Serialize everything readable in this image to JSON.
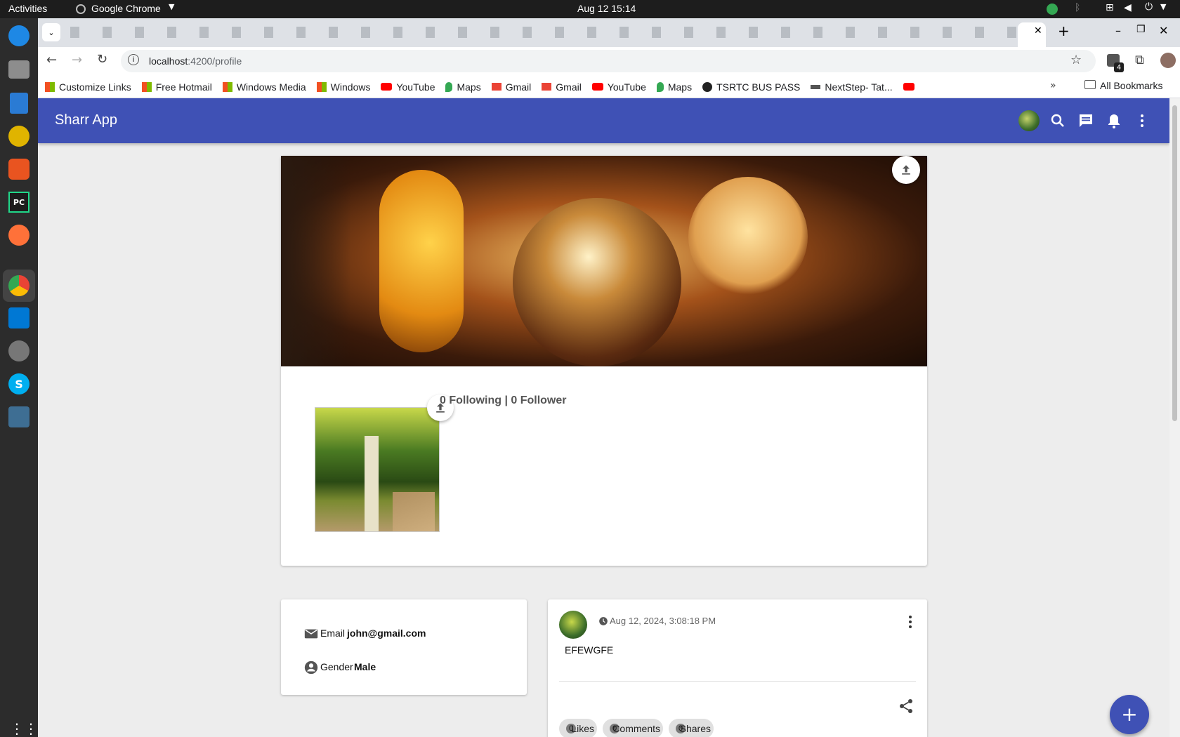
{
  "os": {
    "activities": "Activities",
    "app_name": "Google Chrome",
    "clock": "Aug 12  15:14"
  },
  "browser": {
    "url_host": "localhost",
    "url_path": ":4200/profile",
    "extensions_badge": "4",
    "bookmarks": [
      {
        "label": "Customize Links",
        "icon": "windows"
      },
      {
        "label": "Free Hotmail",
        "icon": "windows"
      },
      {
        "label": "Windows Media",
        "icon": "windows"
      },
      {
        "label": "Windows",
        "icon": "windows"
      },
      {
        "label": "YouTube",
        "icon": "youtube"
      },
      {
        "label": "Maps",
        "icon": "maps"
      },
      {
        "label": "Gmail",
        "icon": "gmail"
      },
      {
        "label": "Gmail",
        "icon": "gmail"
      },
      {
        "label": "YouTube",
        "icon": "youtube"
      },
      {
        "label": "Maps",
        "icon": "maps"
      },
      {
        "label": "TSRTC BUS PASS",
        "icon": "globe"
      },
      {
        "label": "NextStep- Tat...",
        "icon": "tcs"
      }
    ],
    "all_bookmarks": "All Bookmarks"
  },
  "app": {
    "title": "Sharr App",
    "brand_color": "#3f51b5"
  },
  "profile": {
    "follow_text": "0 Following | 0 Follower"
  },
  "about": {
    "email_label": "Email",
    "email_value": "john@gmail.com",
    "gender_label": "Gender",
    "gender_value": "Male"
  },
  "post": {
    "timestamp": "Aug 12, 2024, 3:08:18 PM",
    "text": "EFEWGFE",
    "likes_count": "0",
    "likes_label": "Likes",
    "comments_count": "0",
    "comments_label": "Comments",
    "shares_count": "0",
    "shares_label": "Shares"
  }
}
